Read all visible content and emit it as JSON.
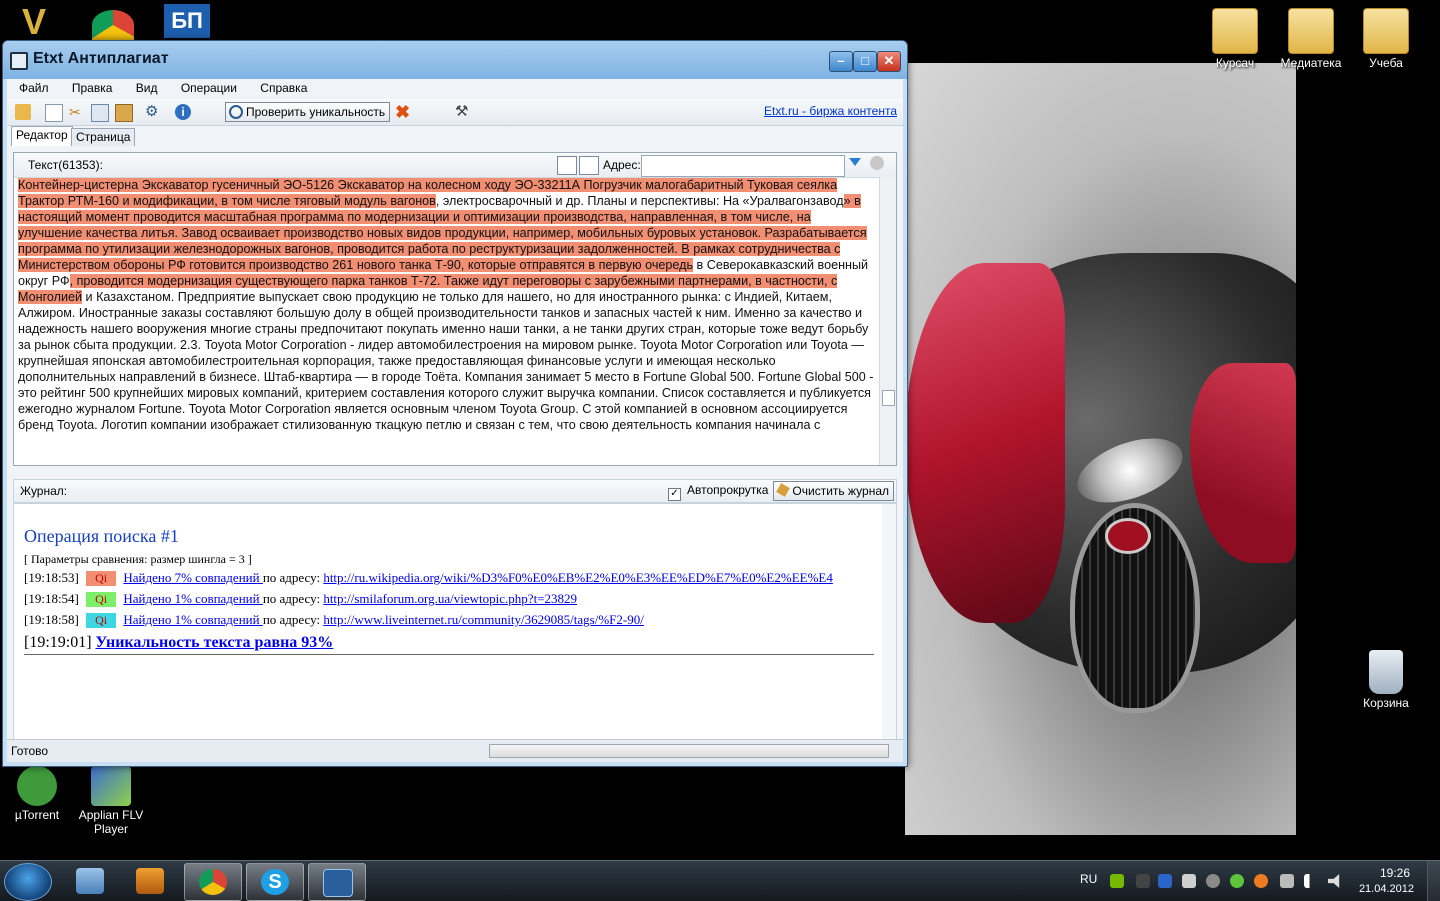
{
  "window": {
    "title": "Etxt Антиплагиат",
    "menu": [
      "Файл",
      "Правка",
      "Вид",
      "Операции",
      "Справка"
    ],
    "check_button": "Проверить уникальность",
    "etxt_link": "Etxt.ru - биржа контента",
    "tabs": [
      "Редактор",
      "Страница"
    ],
    "editor_label": "Текст(61353):",
    "address_label": "Адрес:",
    "address_value": "",
    "journal_label": "Журнал:",
    "autoscroll_label": "Автопрокрутка",
    "autoscroll_checked": true,
    "clear_button": "Очистить журнал",
    "status": "Готово"
  },
  "editor": {
    "segments": [
      {
        "text": "Контейнер-цистерна Экскаватор гусеничный ЭО-5126 Экскаватор на колесном ходу ЭО-33211А Погрузчик малогабаритный Туковая сеялка Трактор РТМ-160 и модификации, в том числе тяговый модуль вагонов",
        "hl": true
      },
      {
        "text": ", электросварочный и др. Планы и перспективы:  На «Уралвагонзавод",
        "hl": false
      },
      {
        "text": "» в настоящий момент проводится масштабная программа по модернизации и оптимизации производства, направленная, в том числе, на улучшение качества литья. Завод осваивает производство новых видов продукции, например, мобильных буровых установок. Разрабатывается программа по утилизации железнодорожных вагонов, проводится работа по реструктуризации задолженностей. В рамках сотрудничества с Министерством обороны РФ готовится производство 261 нового танка Т-90, которые отправятся в первую очередь",
        "hl": true
      },
      {
        "text": " в Северокавказский военный округ РФ",
        "hl": false
      },
      {
        "text": ", проводится модернизация существующего парка танков Т-72. Также идут переговоры с зарубежными партнерами, в частности, с Монголией",
        "hl": true
      },
      {
        "text": " и Казахстаном.  Предприятие выпускает свою продукцию не только для нашего, но для иностранного рынка: с Индией, Китаем, Алжиром. Иностранные заказы составляют большую долу в общей производительности танков и запасных частей к ним. Именно за качество и надежность нашего вооружения многие страны предпочитают покупать именно наши танки, а не танки других стран, которые тоже ведут борьбу за рынок сбыта продукции. 2.3. Toyota Motor Corporation - лидер автомобилестроения на мировом рынке.  Toyota Motor Corporation или Toyota — крупнейшая японская автомобилестроительная корпорация, также предоставляющая финансовые услуги и имеющая несколько дополнительных направлений в бизнесе. Штаб-квартира — в городе Тоёта. Компания занимает 5 место в Fortune Global 500. Fortune Global 500 -  это рейтинг 500 крупнейших мировых компаний, критерием составления которого служит выручка компании. Список составляется и публикуется ежегодно журналом Fortune. Toyota Motor Corporation является основным членом Toyota Group. С этой компанией в основном ассоциируется бренд Toyota. Логотип компании изображает стилизованную ткацкую петлю и связан с тем, что свою деятельность компания начинала с",
        "hl": false
      }
    ]
  },
  "journal": {
    "op_title": "Операция поиска #1",
    "params": "[ Параметры сравнения: размер шингла = 3 ]",
    "rows": [
      {
        "time": "[19:18:53]",
        "badge": "Qi",
        "badge_color": "#f28e72",
        "link": "Найдено 7% совпадений ",
        "mid": "по адресу: ",
        "url": "http://ru.wikipedia.org/wiki/%D3%F0%E0%EB%E2%E0%E3%EE%ED%E7%E0%E2%EE%E4"
      },
      {
        "time": "[19:18:54]",
        "badge": "Qi",
        "badge_color": "#7cf06a",
        "link": "Найдено 1% совпадений ",
        "mid": "по адресу: ",
        "url": "http://smilaforum.org.ua/viewtopic.php?t=23829"
      },
      {
        "time": "[19:18:58]",
        "badge": "Qi",
        "badge_color": "#3ed6e0",
        "link": "Найдено 1% совпадений ",
        "mid": "по адресу: ",
        "url": "http://www.liveinternet.ru/community/3629085/tags/%F2-90/"
      }
    ],
    "final_time": "[19:19:01]",
    "final_text": "Уникальность текста равна 93%"
  },
  "desktop_icons": [
    {
      "label": "Курсач",
      "icon": "folder-icon"
    },
    {
      "label": "Медиатека",
      "icon": "folder-icon"
    },
    {
      "label": "Учеба",
      "icon": "folder-icon"
    },
    {
      "label": "Корзина",
      "icon": "recycle-bin-icon"
    },
    {
      "label": "µTorrent",
      "icon": "utorrent-icon"
    },
    {
      "label": "Applian FLV Player",
      "icon": "flv-player-icon"
    }
  ],
  "taskbar": {
    "pinned": [
      "explorer-icon",
      "media-player-icon",
      "chrome-icon",
      "skype-icon",
      "etxt-icon"
    ],
    "lang": "RU",
    "time": "19:26",
    "date": "21.04.2012"
  }
}
